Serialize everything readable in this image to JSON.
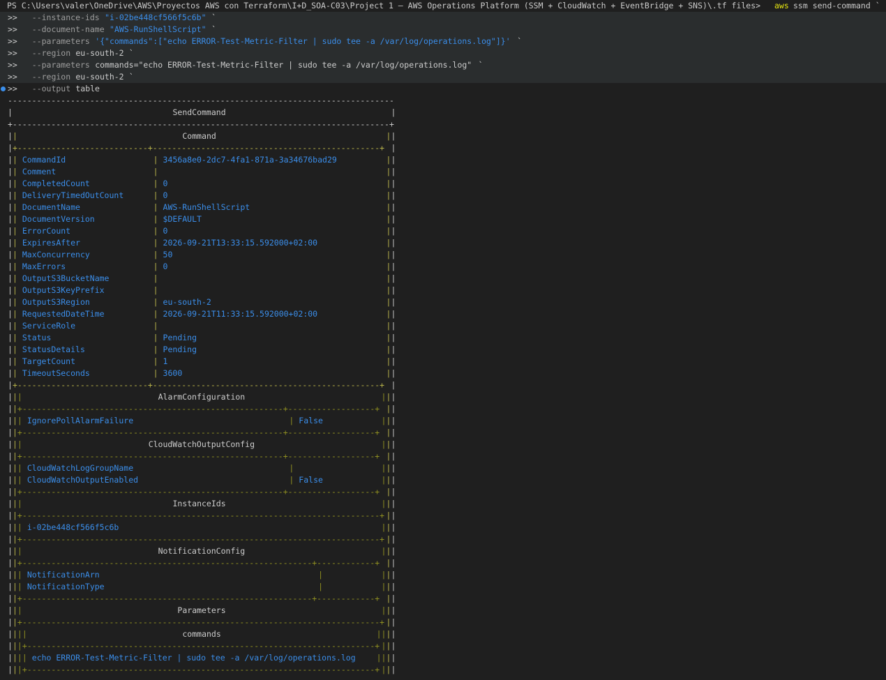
{
  "command": {
    "prompt_prefix": "PS C:\\Users\\valer\\OneDrive\\AWS\\Proyectos AWS con Terraform\\I+D_SOA-C03\\Project 1 – AWS Operations Platform (SSM + CloudWatch + EventBridge + SNS)\\.tf files>",
    "executable": "aws",
    "args": "ssm send-command `",
    "continuation_prompt": ">>",
    "lines": [
      {
        "flag": "--instance-ids",
        "value": "\"i-02be448cf566f5c6b\"",
        "tail": " `",
        "value_color": "blue"
      },
      {
        "flag": "--document-name",
        "value": "\"AWS-RunShellScript\"",
        "tail": " `",
        "value_color": "blue"
      },
      {
        "flag": "--parameters",
        "value": "'{\"commands\":[\"echo ERROR-Test-Metric-Filter | sudo tee -a /var/log/operations.log\"]}'",
        "tail": " `",
        "value_color": "blue"
      },
      {
        "flag": "--region",
        "value": "eu-south-2",
        "tail": " `",
        "value_color": "white"
      },
      {
        "flag": "--parameters",
        "value": "commands=\"echo ERROR-Test-Metric-Filter | sudo tee -a /var/log/operations.log\"",
        "tail": " `",
        "value_color": "white"
      },
      {
        "flag": "--region",
        "value": "eu-south-2",
        "tail": " `",
        "value_color": "white"
      },
      {
        "flag": "--output",
        "value": "table",
        "tail": "",
        "value_color": "white"
      }
    ]
  },
  "table": {
    "title": "SendCommand",
    "section": "Command",
    "fields": [
      {
        "key": "CommandId",
        "value": "3456a8e0-2dc7-4fa1-871a-3a34676bad29"
      },
      {
        "key": "Comment",
        "value": ""
      },
      {
        "key": "CompletedCount",
        "value": "0"
      },
      {
        "key": "DeliveryTimedOutCount",
        "value": "0"
      },
      {
        "key": "DocumentName",
        "value": "AWS-RunShellScript"
      },
      {
        "key": "DocumentVersion",
        "value": "$DEFAULT"
      },
      {
        "key": "ErrorCount",
        "value": "0"
      },
      {
        "key": "ExpiresAfter",
        "value": "2026-09-21T13:33:15.592000+02:00"
      },
      {
        "key": "MaxConcurrency",
        "value": "50"
      },
      {
        "key": "MaxErrors",
        "value": "0"
      },
      {
        "key": "OutputS3BucketName",
        "value": ""
      },
      {
        "key": "OutputS3KeyPrefix",
        "value": ""
      },
      {
        "key": "OutputS3Region",
        "value": "eu-south-2"
      },
      {
        "key": "RequestedDateTime",
        "value": "2026-09-21T11:33:15.592000+02:00"
      },
      {
        "key": "ServiceRole",
        "value": ""
      },
      {
        "key": "Status",
        "value": "Pending"
      },
      {
        "key": "StatusDetails",
        "value": "Pending"
      },
      {
        "key": "TargetCount",
        "value": "1"
      },
      {
        "key": "TimeoutSeconds",
        "value": "3600"
      }
    ],
    "alarm_configuration": {
      "title": "AlarmConfiguration",
      "fields": [
        {
          "key": "IgnorePollAlarmFailure",
          "value": "False"
        }
      ]
    },
    "cloudwatch_output_config": {
      "title": "CloudWatchOutputConfig",
      "fields": [
        {
          "key": "CloudWatchLogGroupName",
          "value": ""
        },
        {
          "key": "CloudWatchOutputEnabled",
          "value": "False"
        }
      ]
    },
    "instance_ids": {
      "title": "InstanceIds",
      "items": [
        "i-02be448cf566f5c6b"
      ]
    },
    "notification_config": {
      "title": "NotificationConfig",
      "fields": [
        {
          "key": "NotificationArn",
          "value": ""
        },
        {
          "key": "NotificationType",
          "value": ""
        }
      ]
    },
    "parameters": {
      "title": "Parameters",
      "commands": {
        "title": "commands",
        "items": [
          "echo ERROR-Test-Metric-Filter | sudo tee -a /var/log/operations.log"
        ]
      }
    }
  },
  "colors": {
    "background": "#1f1f1f",
    "text": "#cccccc",
    "blue": "#3b8eea",
    "yellow": "#e5e510",
    "highlight": "#2a2d2e"
  }
}
